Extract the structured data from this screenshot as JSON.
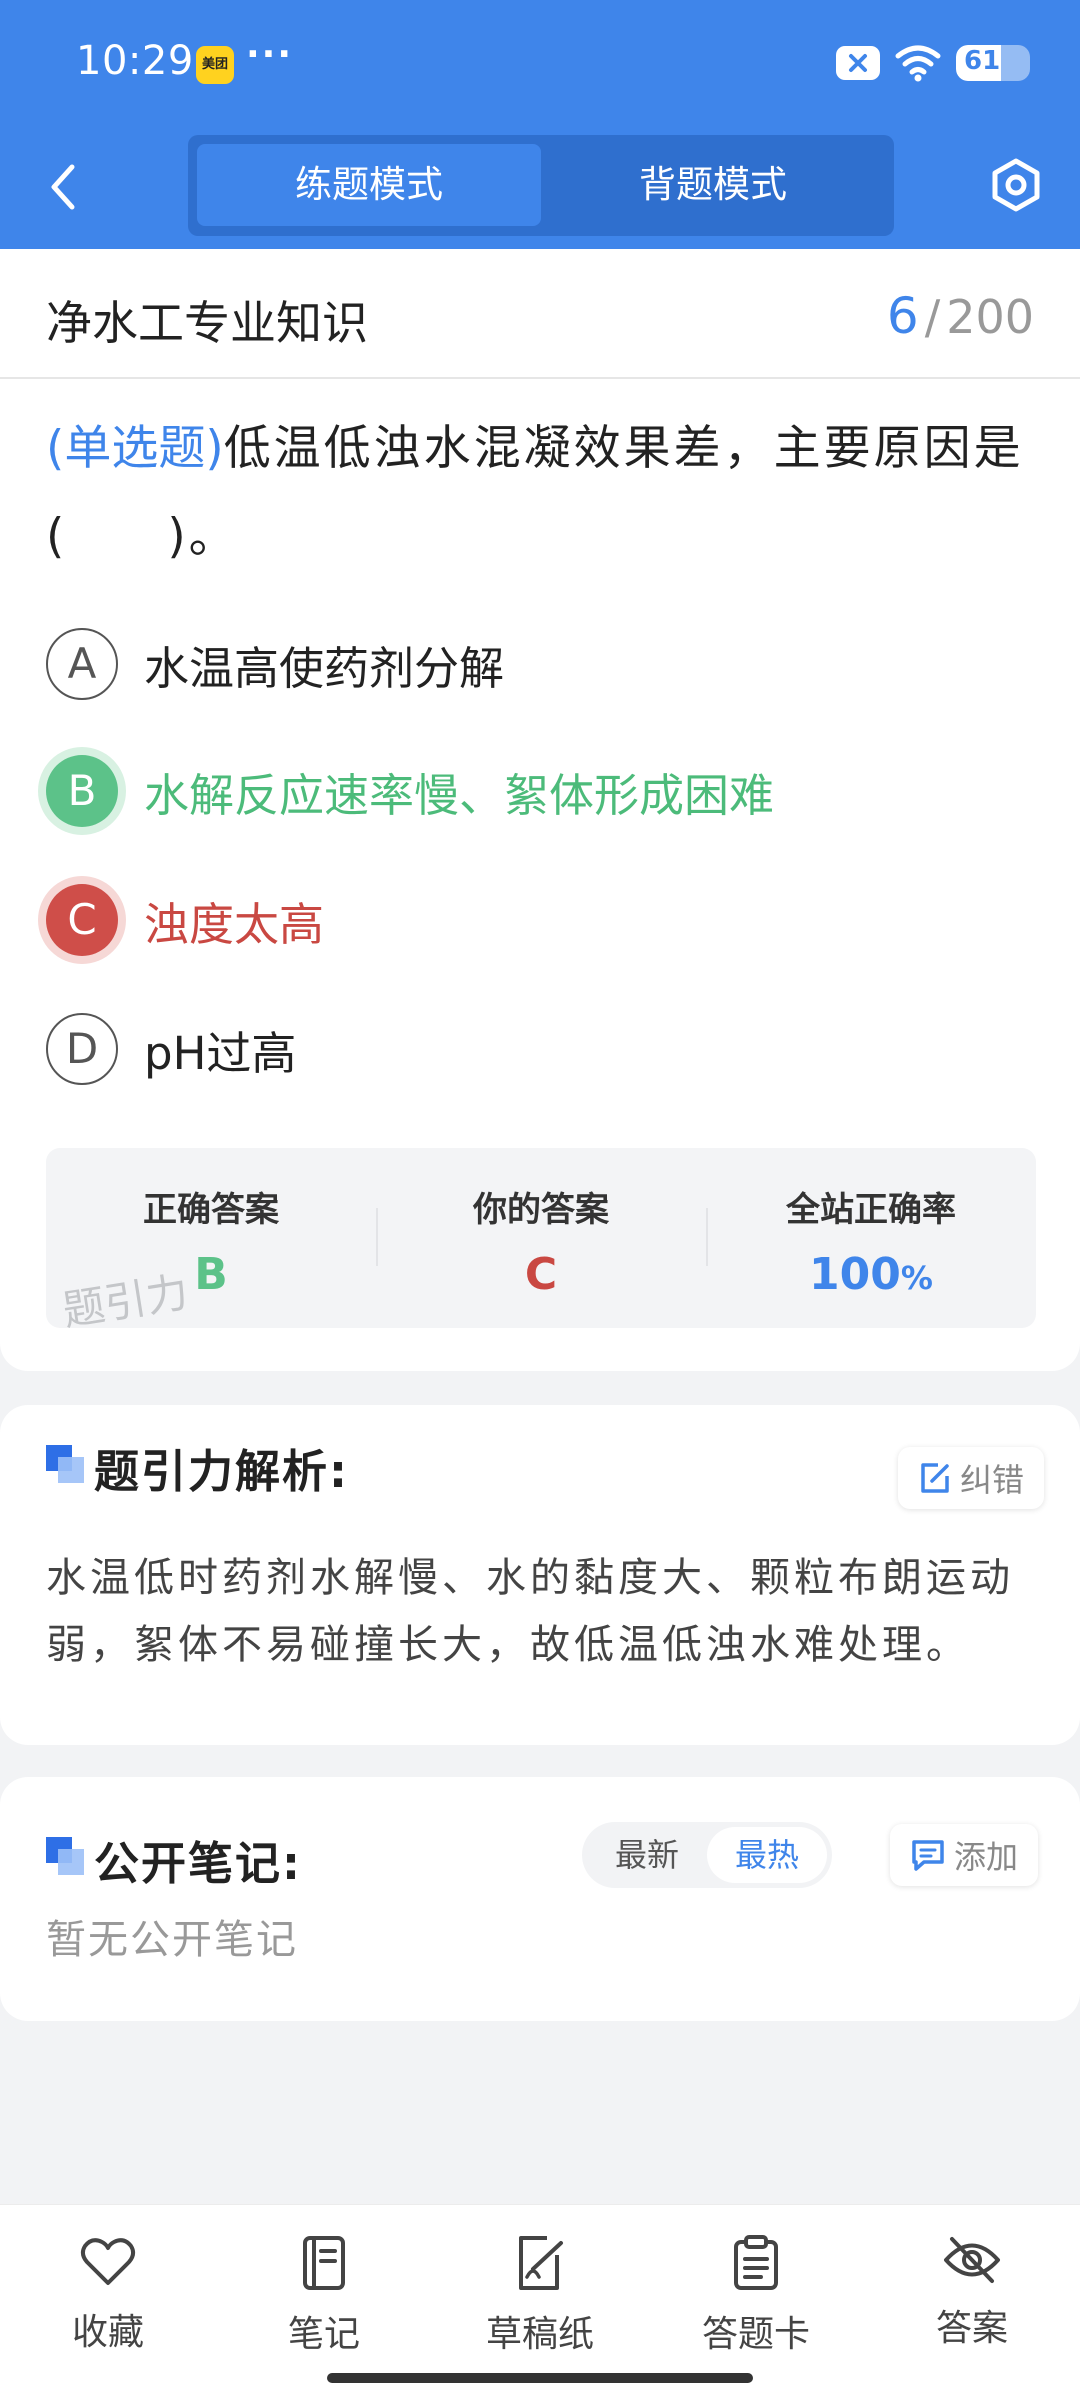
{
  "status_bar": {
    "time": "10:29",
    "app_badge": "美团",
    "more": "···",
    "battery": "61",
    "battery_fraction": 0.61
  },
  "nav": {
    "tabs": [
      {
        "label": "练题模式",
        "active": true
      },
      {
        "label": "背题模式",
        "active": false
      }
    ],
    "back_icon": "chevron-left-icon",
    "settings_icon": "hexagon-settings-icon"
  },
  "question_header": {
    "subject": "净水工专业知识",
    "current": "6",
    "separator": "/",
    "total": "200"
  },
  "question": {
    "type_label": "(单选题)",
    "stem": "低温低浊水混凝效果差，主要原因是(　　)。"
  },
  "options": [
    {
      "letter": "A",
      "text": "水温高使药剂分解",
      "state": "normal"
    },
    {
      "letter": "B",
      "text": "水解反应速率慢、絮体形成困难",
      "state": "correct"
    },
    {
      "letter": "C",
      "text": "浊度太高",
      "state": "wrong"
    },
    {
      "letter": "D",
      "text": "pH过高",
      "state": "normal"
    }
  ],
  "answer_summary": {
    "correct_label": "正确答案",
    "correct_value": "B",
    "yours_label": "你的答案",
    "yours_value": "C",
    "rate_label": "全站正确率",
    "rate_value": "100",
    "rate_unit": "%"
  },
  "watermark": "题引力",
  "analysis": {
    "title": "题引力解析:",
    "report_button": "纠错",
    "text": "水温低时药剂水解慢、水的黏度大、颗粒布朗运动弱，絮体不易碰撞长大，故低温低浊水难处理。"
  },
  "notes": {
    "title": "公开笔记:",
    "sort_options": [
      {
        "label": "最新",
        "active": false
      },
      {
        "label": "最热",
        "active": true
      }
    ],
    "add_button": "添加",
    "empty_text": "暂无公开笔记"
  },
  "toolbar": [
    {
      "label": "收藏",
      "icon": "heart-icon"
    },
    {
      "label": "笔记",
      "icon": "notebook-icon"
    },
    {
      "label": "草稿纸",
      "icon": "draft-paper-icon"
    },
    {
      "label": "答题卡",
      "icon": "answer-sheet-icon"
    },
    {
      "label": "答案",
      "icon": "eye-off-icon"
    }
  ],
  "colors": {
    "brand_blue": "#3f85ea",
    "correct_green": "#5cc289",
    "wrong_red": "#cf4e49"
  }
}
